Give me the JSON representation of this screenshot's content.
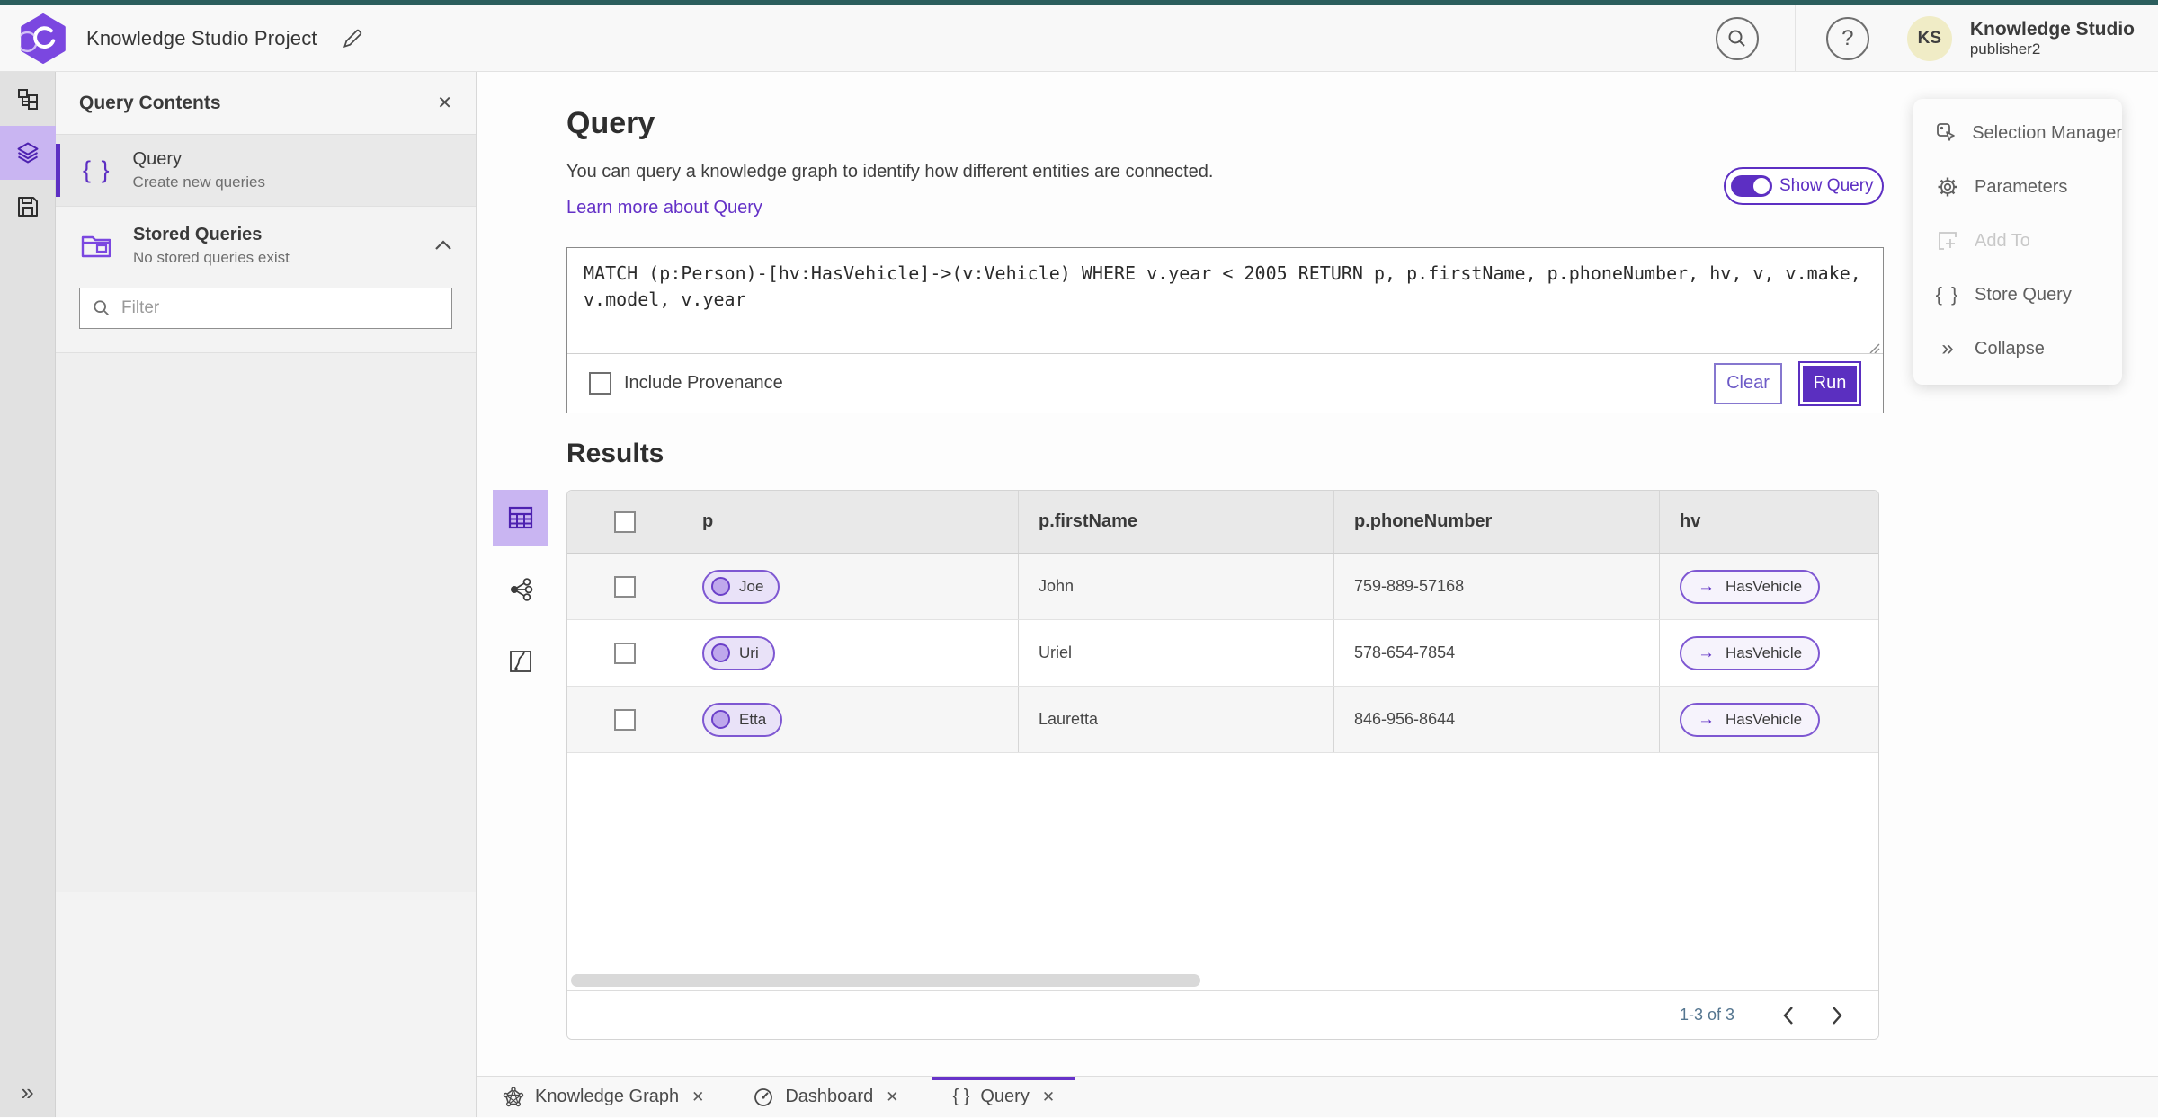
{
  "header": {
    "title": "Knowledge Studio Project",
    "user": {
      "initials": "KS",
      "name": "Knowledge Studio",
      "role": "publisher2"
    }
  },
  "left_panel": {
    "title": "Query Contents",
    "query_item": {
      "title": "Query",
      "subtitle": "Create new queries"
    },
    "stored_queries": {
      "title": "Stored Queries",
      "subtitle": "No stored queries exist"
    },
    "filter_placeholder": "Filter"
  },
  "query": {
    "heading": "Query",
    "description": "You can query a knowledge graph to identify how different entities are connected.",
    "learn_more": "Learn more about Query",
    "show_query": "Show Query",
    "text": "MATCH (p:Person)-[hv:HasVehicle]->(v:Vehicle) WHERE v.year < 2005 RETURN p, p.firstName, p.phoneNumber, hv, v, v.make, v.model, v.year",
    "include_provenance": "Include Provenance",
    "clear": "Clear",
    "run": "Run"
  },
  "results": {
    "heading": "Results",
    "columns": [
      "p",
      "p.firstName",
      "p.phoneNumber",
      "hv"
    ],
    "rows": [
      {
        "p": "Joe",
        "firstName": "John",
        "phoneNumber": "759-889-57168",
        "hv": "HasVehicle",
        "arrow": "→"
      },
      {
        "p": "Uri",
        "firstName": "Uriel",
        "phoneNumber": "578-654-7854",
        "hv": "HasVehicle",
        "arrow": "→"
      },
      {
        "p": "Etta",
        "firstName": "Lauretta",
        "phoneNumber": "846-956-8644",
        "hv": "HasVehicle",
        "arrow": "→"
      }
    ],
    "pagination": "1-3 of 3"
  },
  "context_menu": {
    "items": [
      {
        "label": "Selection Manager",
        "disabled": false
      },
      {
        "label": "Parameters",
        "disabled": false
      },
      {
        "label": "Add To",
        "disabled": true
      },
      {
        "label": "Store Query",
        "disabled": false
      },
      {
        "label": "Collapse",
        "disabled": false
      }
    ]
  },
  "tabs": [
    {
      "label": "Knowledge Graph",
      "active": false
    },
    {
      "label": "Dashboard",
      "active": false
    },
    {
      "label": "Query",
      "active": true
    }
  ],
  "glyphs": {
    "close": "✕",
    "braces": "{ }",
    "chevrons": "»"
  },
  "colors": {
    "accent": "#5d2fc3",
    "selection_bg": "#c9b5f2",
    "top_stripe": "#2b5e5d",
    "avatar_bg": "#f0ecc6",
    "link": "#6431c7"
  }
}
